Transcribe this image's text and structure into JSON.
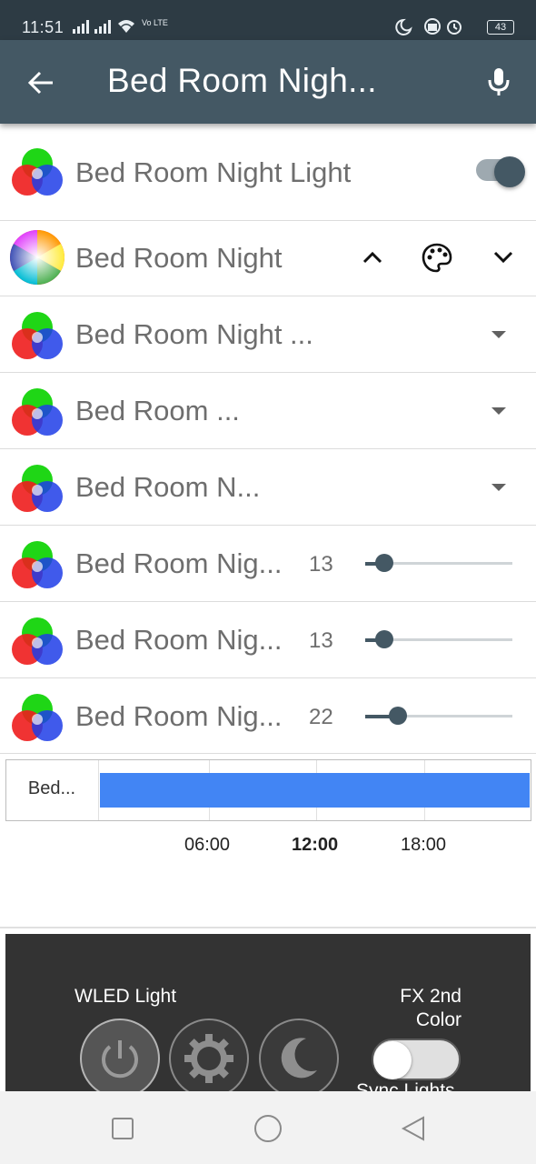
{
  "status_bar": {
    "time": "11:51",
    "network": "Vo LTE",
    "battery": "43"
  },
  "app_bar": {
    "title": "Bed Room Nigh...",
    "back_icon": "arrow-left-icon",
    "mic_icon": "microphone-icon"
  },
  "entities": [
    {
      "name": "Bed Room Night Light",
      "control": "toggle",
      "state": "on"
    },
    {
      "name": "Bed Room Night",
      "control": "color-controls"
    },
    {
      "name": "Bed Room Night ...",
      "control": "dropdown"
    },
    {
      "name": "Bed Room ...",
      "control": "dropdown"
    },
    {
      "name": "Bed Room N...",
      "control": "dropdown"
    },
    {
      "name": "Bed Room Nig...",
      "control": "slider",
      "value": "13",
      "fraction": 0.13
    },
    {
      "name": "Bed Room Nig...",
      "control": "slider",
      "value": "13",
      "fraction": 0.13
    },
    {
      "name": "Bed Room Nig...",
      "control": "slider",
      "value": "22",
      "fraction": 0.22
    }
  ],
  "timeline": {
    "label": "Bed...",
    "ticks": [
      "06:00",
      "12:00",
      "18:00"
    ],
    "bold_tick": "12:00",
    "bar_color": "#4285f4"
  },
  "panel": {
    "title": "WLED Light",
    "fx_label": "FX 2nd Color",
    "sync_label": "Sync Lights",
    "buttons": [
      "power-icon",
      "gear-icon",
      "moon-icon"
    ]
  },
  "colors": {
    "status_bar": "#2d3b44",
    "app_bar": "#445864",
    "accent": "#445864",
    "panel": "#333333"
  }
}
